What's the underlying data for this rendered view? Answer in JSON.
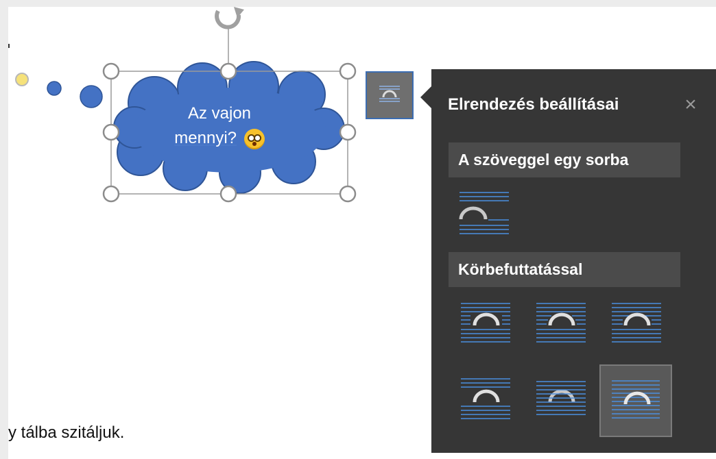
{
  "document": {
    "body_text": "y tálba szitáljuk."
  },
  "shape": {
    "type": "thought-cloud",
    "fill_color": "#4472c4",
    "outline_color": "#2f5597",
    "text_line1": "Az vajon",
    "text_line2": "mennyi?",
    "emoji": "flushed-face-emoji"
  },
  "layout_options_button": {
    "icon": "layout-options-icon"
  },
  "layout_panel": {
    "title": "Elrendezés beállításai",
    "close_icon": "×",
    "sections": [
      {
        "heading": "A szöveggel egy sorba",
        "options": [
          "in-line-with-text"
        ]
      },
      {
        "heading": "Körbefuttatással",
        "options": [
          "square",
          "tight",
          "through",
          "top-and-bottom",
          "behind-text",
          "in-front-of-text"
        ],
        "selected": "in-front-of-text"
      }
    ]
  },
  "colors": {
    "panel_bg": "#363636",
    "section_bg": "#4b4b4b",
    "accent_line": "#4a8fe0",
    "handle_fill": "#ffffff",
    "handle_stroke": "#8c8c8c"
  }
}
